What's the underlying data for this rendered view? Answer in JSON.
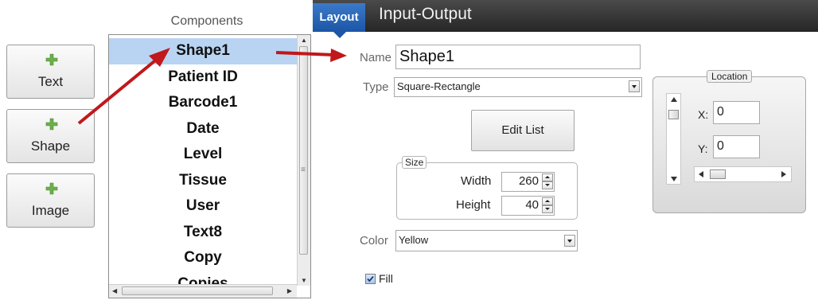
{
  "add_buttons": [
    {
      "label": "Text"
    },
    {
      "label": "Shape"
    },
    {
      "label": "Image"
    }
  ],
  "components": {
    "title": "Components",
    "items": [
      "Shape1",
      "Patient ID",
      "Barcode1",
      "Date",
      "Level",
      "Tissue",
      "User",
      "Text8",
      "Copy",
      "Copies"
    ],
    "selected": "Shape1"
  },
  "tabs": [
    {
      "label": "Layout",
      "active": true
    },
    {
      "label": "Input-Output",
      "active": false
    }
  ],
  "form": {
    "name_label": "Name",
    "name_value": "Shape1",
    "type_label": "Type",
    "type_value": "Square-Rectangle",
    "edit_list_label": "Edit List",
    "size_legend": "Size",
    "width_label": "Width",
    "width_value": "260",
    "height_label": "Height",
    "height_value": "40",
    "color_label": "Color",
    "color_value": "Yellow",
    "fill_label": "Fill",
    "fill_checked": true
  },
  "location": {
    "legend": "Location",
    "x_label": "X:",
    "x_value": "0",
    "y_label": "Y:",
    "y_value": "0"
  },
  "colors": {
    "accent": "#1c56a6",
    "selection": "#b9d4f3",
    "arrow": "#c0181b",
    "plus": "#6ab04c"
  },
  "icons": [
    "plus-icon",
    "dropdown-arrow-icon",
    "spin-up-icon",
    "spin-down-icon",
    "checkbox-icon"
  ]
}
